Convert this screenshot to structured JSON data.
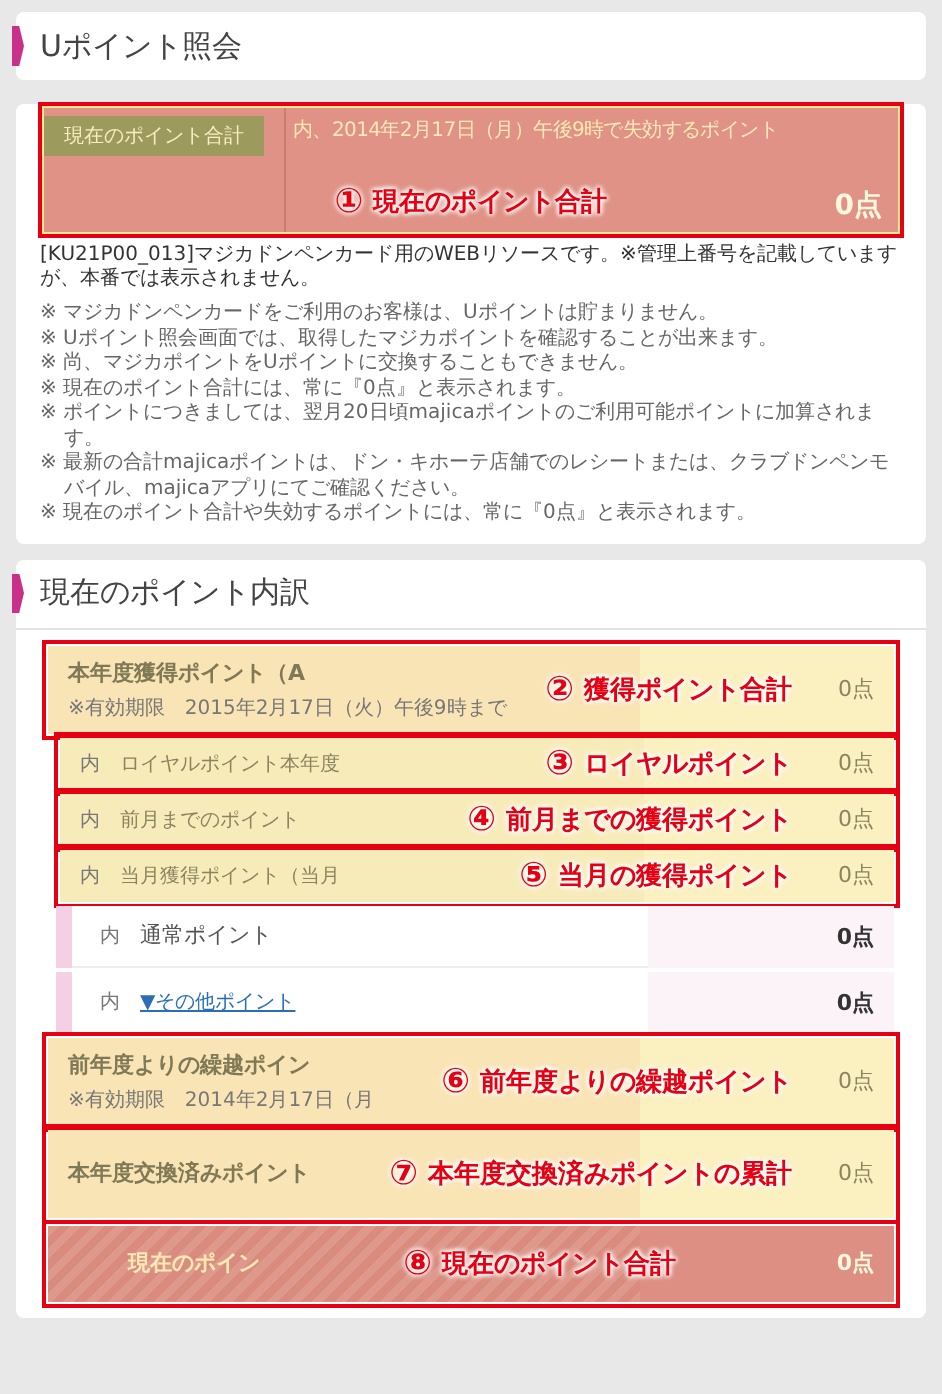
{
  "section_1": {
    "title": "Uポイント照会"
  },
  "summary": {
    "tag": "現在のポイント合計",
    "expiry_label": "内、2014年2月17日（月）午後9時で失効するポイント",
    "expiry_value": "0点",
    "annotation": {
      "number": "①",
      "text": "現在のポイント合計"
    }
  },
  "system_note": "[KU21P00_013]マジカドンペンカード用のWEBリソースです。※管理上番号を記載していますが、本番では表示されません。",
  "notes": [
    "※ マジカドンペンカードをご利用のお客様は、Uポイントは貯まりません。",
    "※ Uポイント照会画面では、取得したマジカポイントを確認することが出来ます。",
    "※ 尚、マジカポイントをUポイントに交換することもできません。",
    "※ 現在のポイント合計には、常に『0点』と表示されます。",
    "※ ポイントにつきましては、翌月20日頃majicaポイントのご利用可能ポイントに加算されます。",
    "※ 最新の合計majicaポイントは、ドン・キホーテ店舗でのレシートまたは、クラブドンペンモバイル、majicaアプリにてご確認ください。",
    "※ 現在のポイント合計や失効するポイントには、常に『0点』と表示されます。"
  ],
  "section_2": {
    "title": "現在のポイント内訳"
  },
  "rows": [
    {
      "kind": "major",
      "label": "本年度獲得ポイント（A",
      "note": "※有効期限　2015年2月17日（火）午後9時まで",
      "value": "0点",
      "annotation": {
        "number": "②",
        "text": "獲得ポイント合計"
      }
    },
    {
      "kind": "sub",
      "prefix": "内",
      "label": "ロイヤルポイント本年度",
      "value": "0点",
      "annotation": {
        "number": "③",
        "text": "ロイヤルポイント"
      }
    },
    {
      "kind": "sub",
      "prefix": "内",
      "label": "前月までのポイント",
      "value": "0点",
      "annotation": {
        "number": "④",
        "text": "前月までの獲得ポイント"
      }
    },
    {
      "kind": "sub",
      "prefix": "内",
      "label": "当月獲得ポイント（当月",
      "value": "0点",
      "annotation": {
        "number": "⑤",
        "text": "当月の獲得ポイント"
      }
    },
    {
      "kind": "plain",
      "prefix": "内",
      "label": "通常ポイント",
      "value": "0点"
    },
    {
      "kind": "link",
      "prefix": "内",
      "label": "▼その他ポイント",
      "value": "0点"
    },
    {
      "kind": "major",
      "label": "前年度よりの繰越ポイン",
      "note": "※有効期限　2014年2月17日（月",
      "value": "0点",
      "annotation": {
        "number": "⑥",
        "text": "前年度よりの繰越ポイント"
      }
    },
    {
      "kind": "major",
      "label": "本年度交換済みポイント",
      "value": "0点",
      "annotation": {
        "number": "⑦",
        "text": "本年度交換済みポイントの累計"
      }
    },
    {
      "kind": "total",
      "label": "現在のポイン",
      "value": "0点",
      "annotation": {
        "number": "⑧",
        "text": "現在のポイント合計"
      }
    }
  ]
}
